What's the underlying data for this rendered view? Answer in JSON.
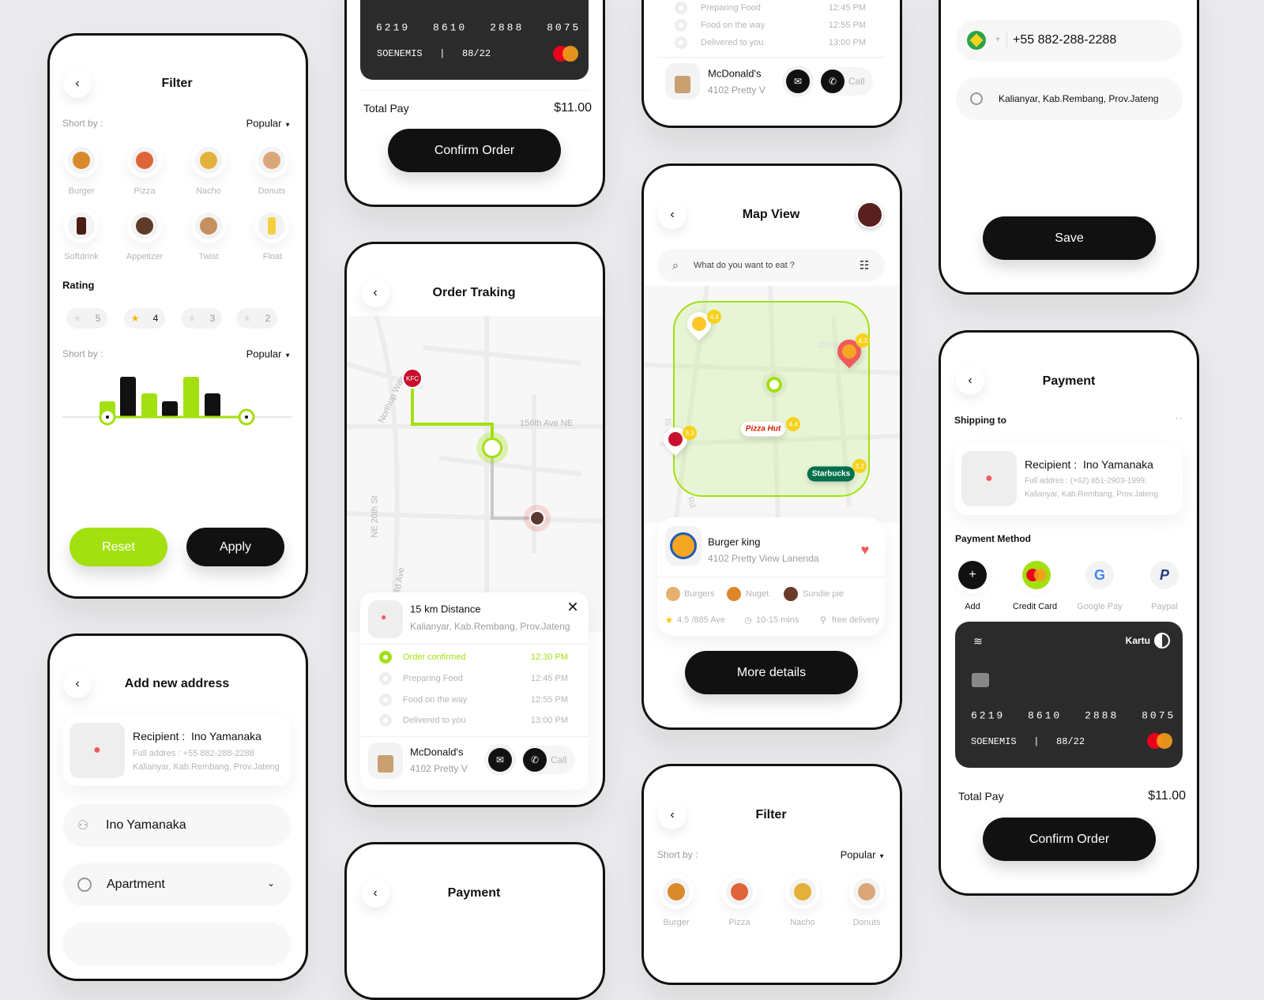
{
  "colors": {
    "accent": "#a3e010",
    "dark": "#111111",
    "background": "#ebebed"
  },
  "filter": {
    "title": "Filter",
    "sort_label": "Short by :",
    "sort_value": "Popular",
    "foods": [
      "Burger",
      "Pizza",
      "Nacho",
      "Donuts",
      "Softdrink",
      "Appetizer",
      "Twist",
      "Float"
    ],
    "rating_label": "Rating",
    "ratings": [
      "5",
      "4",
      "3",
      "2"
    ],
    "selected_rating": "4",
    "sort_label2": "Short by :",
    "sort_value2": "Popular",
    "reset": "Reset",
    "apply": "Apply"
  },
  "add_address": {
    "title": "Add new address",
    "recipient_label": "Recipient :",
    "recipient_name": "Ino Yamanaka",
    "full_address_line1": "Full addres : +55 882-288-2288",
    "full_address_line2": "Kalianyar, Kab.Rembang, Prov.Jateng",
    "name_value": "Ino Yamanaka",
    "type_value": "Apartment"
  },
  "payment_top": {
    "card_number": [
      "6219",
      "8610",
      "2888",
      "8075"
    ],
    "card_holder": "SOENEMIS",
    "card_expiry": "88/22",
    "total_label": "Total Pay",
    "total_value": "$11.00",
    "confirm": "Confirm Order"
  },
  "order_tracking": {
    "title": "Order Traking",
    "streets": [
      "Northup Way",
      "156th Ave NE",
      "NE 20th St",
      "Rd Ave"
    ],
    "distance": "15 km Distance",
    "address": "Kalianyar, Kab.Rembang, Prov.Jateng",
    "steps": [
      {
        "label": "Order confirmed",
        "time": "12:30  PM"
      },
      {
        "label": "Preparing Food",
        "time": "12:45  PM"
      },
      {
        "label": "Food on the way",
        "time": "12:55  PM"
      },
      {
        "label": "Delivered to you",
        "time": "13:00  PM"
      }
    ],
    "merchant": "McDonald's",
    "merchant_address": "4102  Pretty V",
    "call": "Call"
  },
  "payment_bottom": {
    "title": "Payment"
  },
  "tracking_top": {
    "steps": [
      {
        "label": "Preparing Food",
        "time": "12:45  PM"
      },
      {
        "label": "Food on the way",
        "time": "12:55  PM"
      },
      {
        "label": "Delivered to you",
        "time": "13:00  PM"
      }
    ],
    "merchant": "McDonald's",
    "merchant_address": "4102  Pretty V",
    "call": "Call"
  },
  "map_view": {
    "title": "Map View",
    "search_placeholder": "What do you want to eat ?",
    "street_labels": [
      "156th",
      "th St",
      "Rd"
    ],
    "pins": [
      {
        "name": "McDonald's",
        "rating": "4.4"
      },
      {
        "name": "Burger King",
        "rating": "4.3"
      },
      {
        "name": "Pizza Hut",
        "rating": "4.4"
      },
      {
        "name": "KFC",
        "rating": "3.3"
      },
      {
        "name": "Starbucks",
        "rating": "3.2"
      }
    ],
    "restaurant": "Burger king",
    "restaurant_address": "4102  Pretty View Lanenda",
    "tags": [
      "Burgers",
      "Nuget",
      "Sundie pie"
    ],
    "rating": "4.5 /885 Ave",
    "time": "10-15 mins",
    "delivery": "free delivery",
    "more": "More details"
  },
  "filter_bottom": {
    "title": "Filter",
    "sort_label": "Short by :",
    "sort_value": "Popular",
    "foods": [
      "Burger",
      "Pizza",
      "Nacho",
      "Donuts"
    ]
  },
  "address_form": {
    "phone": "+55 882-288-2288",
    "address": "Kalianyar, Kab.Rembang, Prov.Jateng",
    "save": "Save"
  },
  "payment": {
    "title": "Payment",
    "shipping_label": "Shipping to",
    "recipient_label": "Recipient :",
    "recipient_name": "Ino Yamanaka",
    "full_address_line1": "Full addres : (+62) 851-2903-1999,",
    "full_address_line2": "Kalianyar, Kab.Rembang, Prov.Jateng",
    "method_label": "Payment Method",
    "methods": [
      "Add",
      "Credit Card",
      "Google Pay",
      "Paypal"
    ],
    "selected_method": "Credit Card",
    "card_brand": "Kartu",
    "card_number": [
      "6219",
      "8610",
      "2888",
      "8075"
    ],
    "card_holder": "SOENEMIS",
    "card_expiry": "88/22",
    "total_label": "Total Pay",
    "total_value": "$11.00",
    "confirm": "Confirm Order"
  }
}
